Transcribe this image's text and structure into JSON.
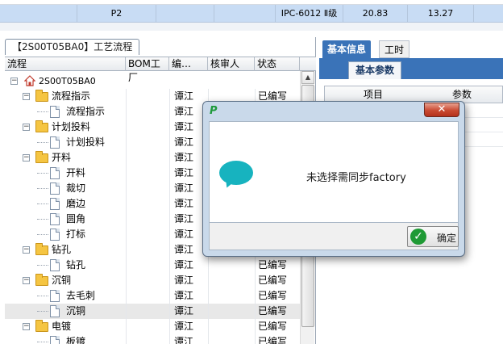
{
  "top_row": {
    "cells": [
      "P2",
      "IPC-6012 Ⅱ级",
      "20.83",
      "13.27"
    ]
  },
  "left_panel": {
    "tab_title": "【2S00T05BA0】工艺流程",
    "columns": [
      "流程",
      "BOM工厂",
      "编…",
      "核审人",
      "状态"
    ],
    "root": "2S00T05BA0",
    "rows": [
      {
        "label": "流程指示",
        "type": "folder",
        "level": 1,
        "col3": "谭江",
        "status": "已编写"
      },
      {
        "label": "流程指示",
        "type": "doc",
        "level": 2,
        "col3": "谭江",
        "status": ""
      },
      {
        "label": "计划投料",
        "type": "folder",
        "level": 1,
        "col3": "谭江",
        "status": ""
      },
      {
        "label": "计划投料",
        "type": "doc",
        "level": 2,
        "col3": "谭江",
        "status": ""
      },
      {
        "label": "开料",
        "type": "folder",
        "level": 1,
        "col3": "谭江",
        "status": ""
      },
      {
        "label": "开料",
        "type": "doc",
        "level": 2,
        "col3": "谭江",
        "status": ""
      },
      {
        "label": "裁切",
        "type": "doc",
        "level": 2,
        "col3": "谭江",
        "status": ""
      },
      {
        "label": "磨边",
        "type": "doc",
        "level": 2,
        "col3": "谭江",
        "status": ""
      },
      {
        "label": "圆角",
        "type": "doc",
        "level": 2,
        "col3": "谭江",
        "status": ""
      },
      {
        "label": "打标",
        "type": "doc",
        "level": 2,
        "col3": "谭江",
        "status": ""
      },
      {
        "label": "钻孔",
        "type": "folder",
        "level": 1,
        "col3": "谭江",
        "status": ""
      },
      {
        "label": "钻孔",
        "type": "doc",
        "level": 2,
        "col3": "谭江",
        "status": "已编写"
      },
      {
        "label": "沉铜",
        "type": "folder",
        "level": 1,
        "col3": "谭江",
        "status": "已编写"
      },
      {
        "label": "去毛刺",
        "type": "doc",
        "level": 2,
        "col3": "谭江",
        "status": "已编写"
      },
      {
        "label": "沉铜",
        "type": "doc",
        "level": 2,
        "col3": "谭江",
        "status": "已编写"
      },
      {
        "label": "电镀",
        "type": "folder",
        "level": 1,
        "col3": "谭江",
        "status": "已编写"
      },
      {
        "label": "板镀",
        "type": "doc",
        "level": 2,
        "col3": "谭江",
        "status": "已编写"
      }
    ]
  },
  "right_panel": {
    "tabs": [
      "基本信息",
      "工时"
    ],
    "subtab": "基本参数",
    "columns": [
      "项目",
      "参数"
    ]
  },
  "dialog": {
    "close_label": "✕",
    "message": "未选择需同步factory",
    "ok_label": "确定"
  }
}
